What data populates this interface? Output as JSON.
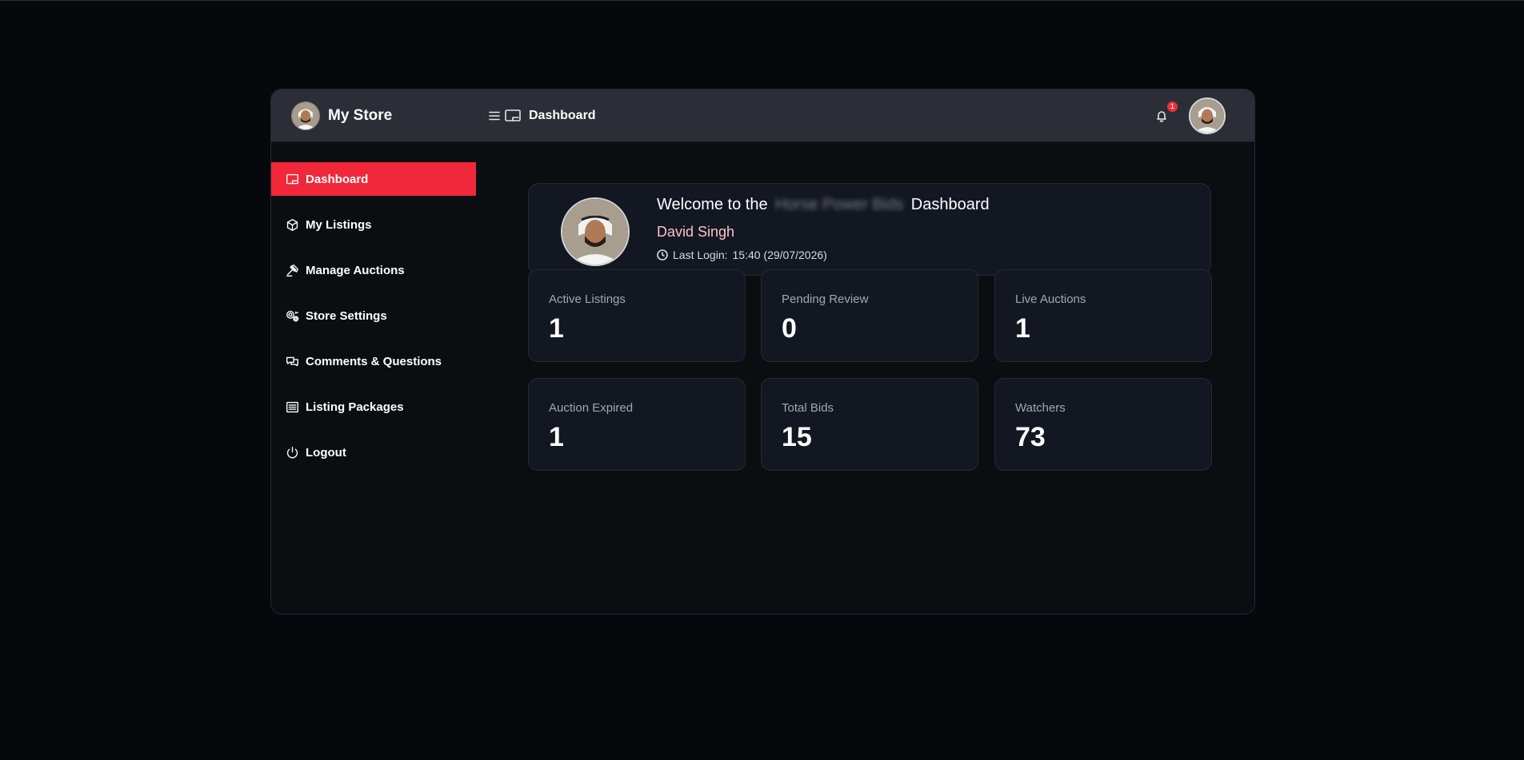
{
  "store": {
    "name": "My Store"
  },
  "sidebar": {
    "items": [
      {
        "label": "Dashboard",
        "icon": "dashboard-icon",
        "active": true
      },
      {
        "label": "My Listings",
        "icon": "box-icon",
        "active": false
      },
      {
        "label": "Manage Auctions",
        "icon": "gavel-icon",
        "active": false
      },
      {
        "label": "Store Settings",
        "icon": "settings-icon",
        "active": false
      },
      {
        "label": "Comments & Questions",
        "icon": "chat-icon",
        "active": false
      },
      {
        "label": "Listing Packages",
        "icon": "list-icon",
        "active": false
      },
      {
        "label": "Logout",
        "icon": "power-icon",
        "active": false
      }
    ]
  },
  "header": {
    "title": "Dashboard",
    "notification_count": "1"
  },
  "welcome": {
    "title_prefix": "Welcome to the",
    "brand_blurred": "Horse Power Bids",
    "title_suffix": "Dashboard",
    "user_name": "David Singh",
    "last_login_label": "Last Login:",
    "last_login_value": "15:40 (29/07/2026)"
  },
  "stats": [
    {
      "label": "Active Listings",
      "value": "1"
    },
    {
      "label": "Pending Review",
      "value": "0"
    },
    {
      "label": "Live Auctions",
      "value": "1"
    },
    {
      "label": "Auction Expired",
      "value": "1"
    },
    {
      "label": "Total Bids",
      "value": "15"
    },
    {
      "label": "Watchers",
      "value": "73"
    }
  ],
  "colors": {
    "accent": "#f1283a",
    "header_bg": "#2b2d37",
    "card_bg": "#131722",
    "user_name": "#f6c3c8"
  }
}
